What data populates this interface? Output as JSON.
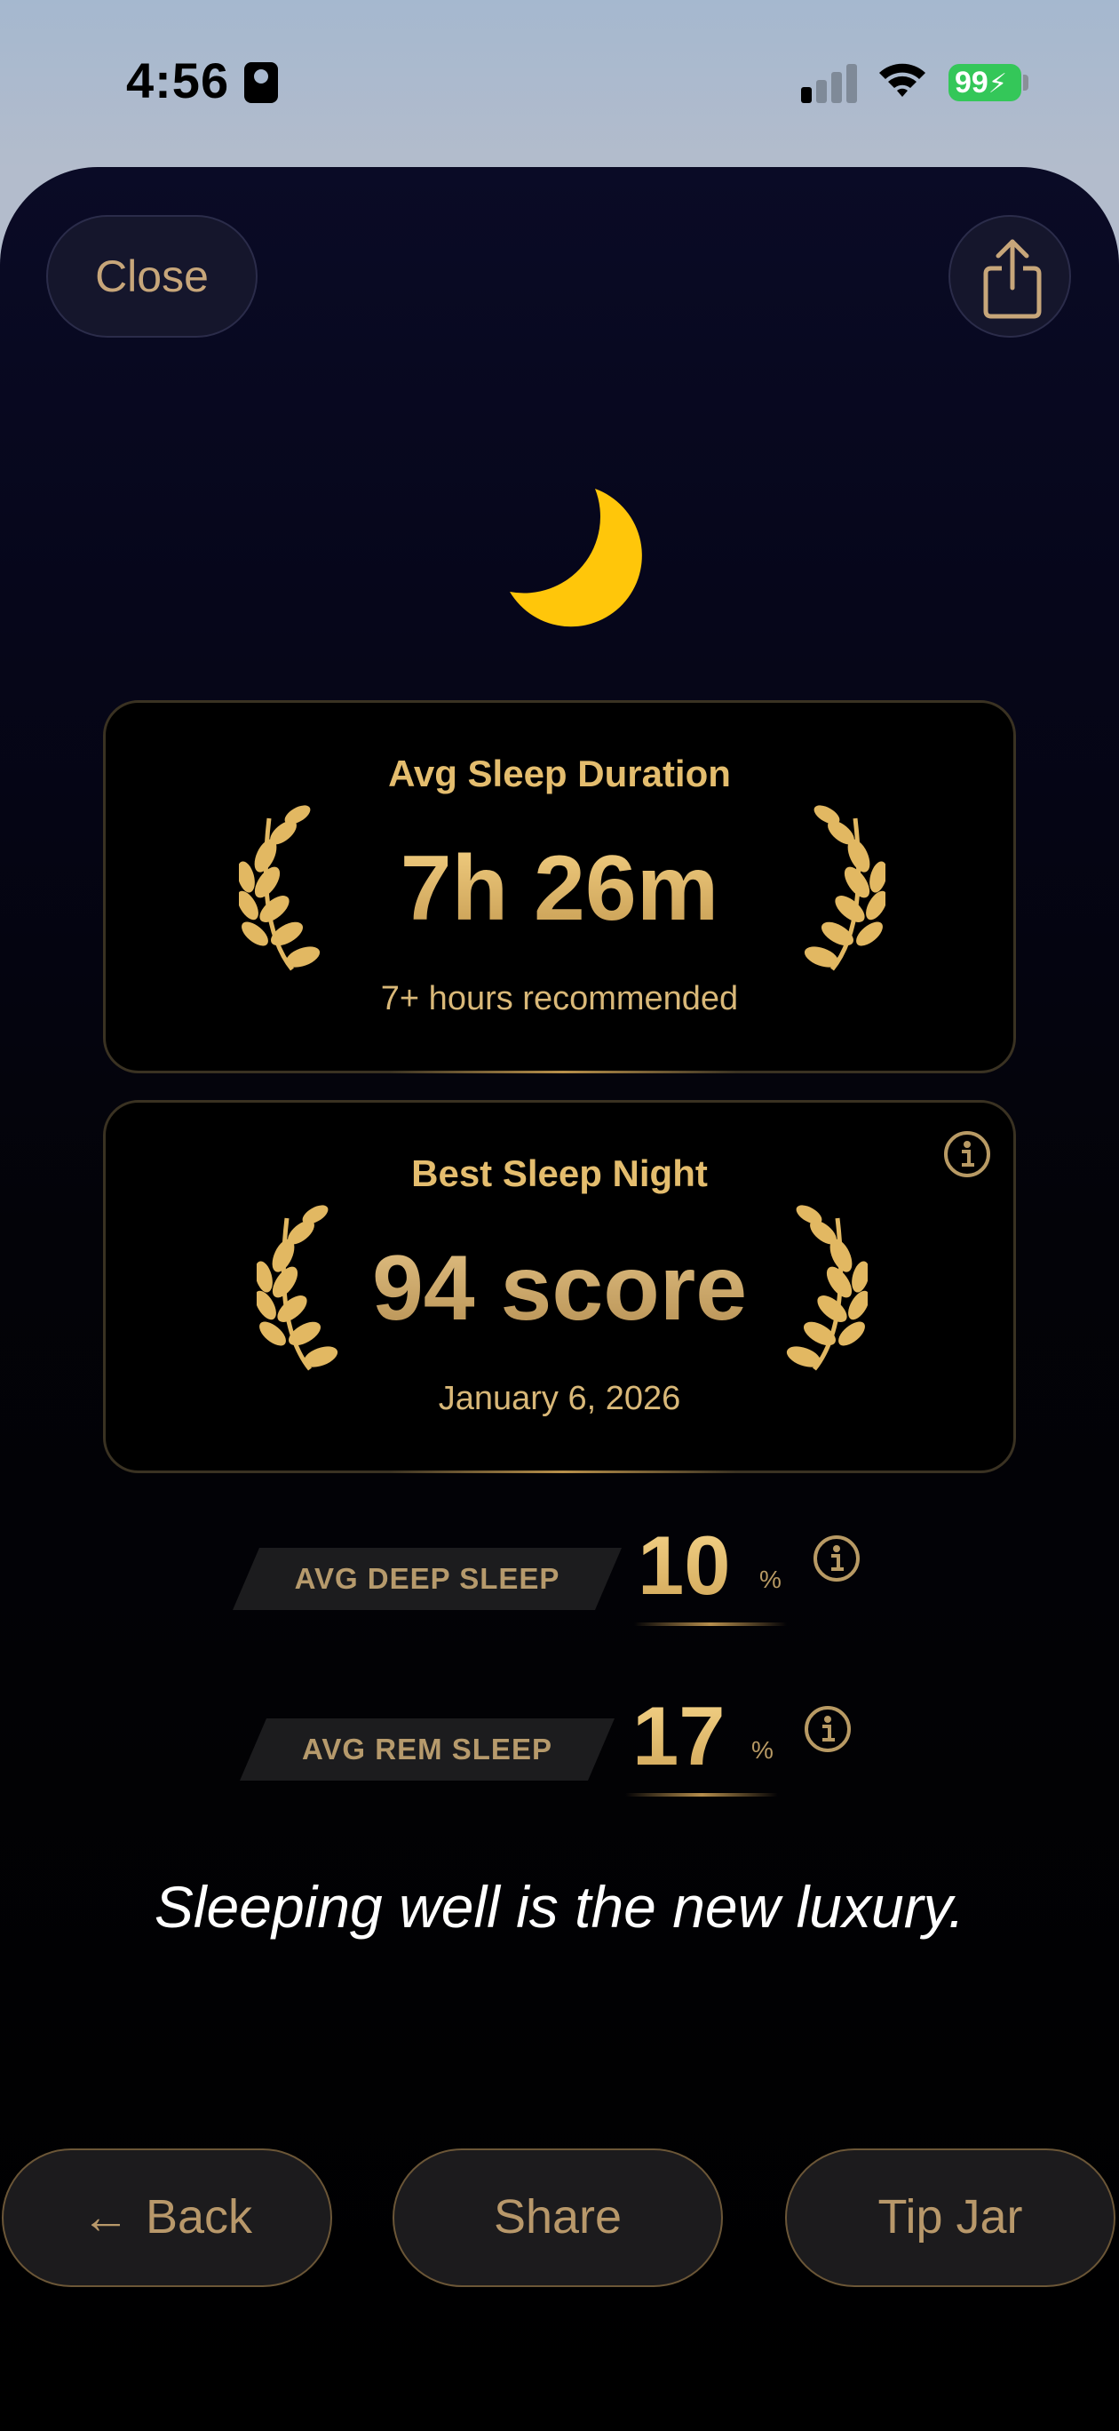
{
  "status_bar": {
    "time": "4:56",
    "battery": "99",
    "icons": [
      "contact-card-icon",
      "cellular-signal-icon",
      "wifi-icon",
      "battery-charging-icon"
    ],
    "battery_color": "#34c759"
  },
  "header": {
    "close_label": "Close",
    "share_icon": "share-icon"
  },
  "hero_icon": "crescent-moon-icon",
  "cards": {
    "avg_duration": {
      "title": "Avg Sleep Duration",
      "value": "7h 26m",
      "subtitle": "7+ hours recommended"
    },
    "best_night": {
      "title": "Best Sleep Night",
      "value": "94 score",
      "subtitle": "January 6, 2026"
    }
  },
  "stats": {
    "deep": {
      "label": "AVG DEEP SLEEP",
      "value": "10",
      "unit": "%"
    },
    "rem": {
      "label": "AVG REM SLEEP",
      "value": "17",
      "unit": "%"
    }
  },
  "tagline": "Sleeping well is the new luxury.",
  "footer": {
    "back_arrow": "←",
    "back_label": "Back",
    "share_label": "Share",
    "tip_label": "Tip Jar"
  },
  "colors": {
    "gold": "#e4bd6e",
    "moon": "#ffc60a",
    "button_text": "#b8986a"
  }
}
